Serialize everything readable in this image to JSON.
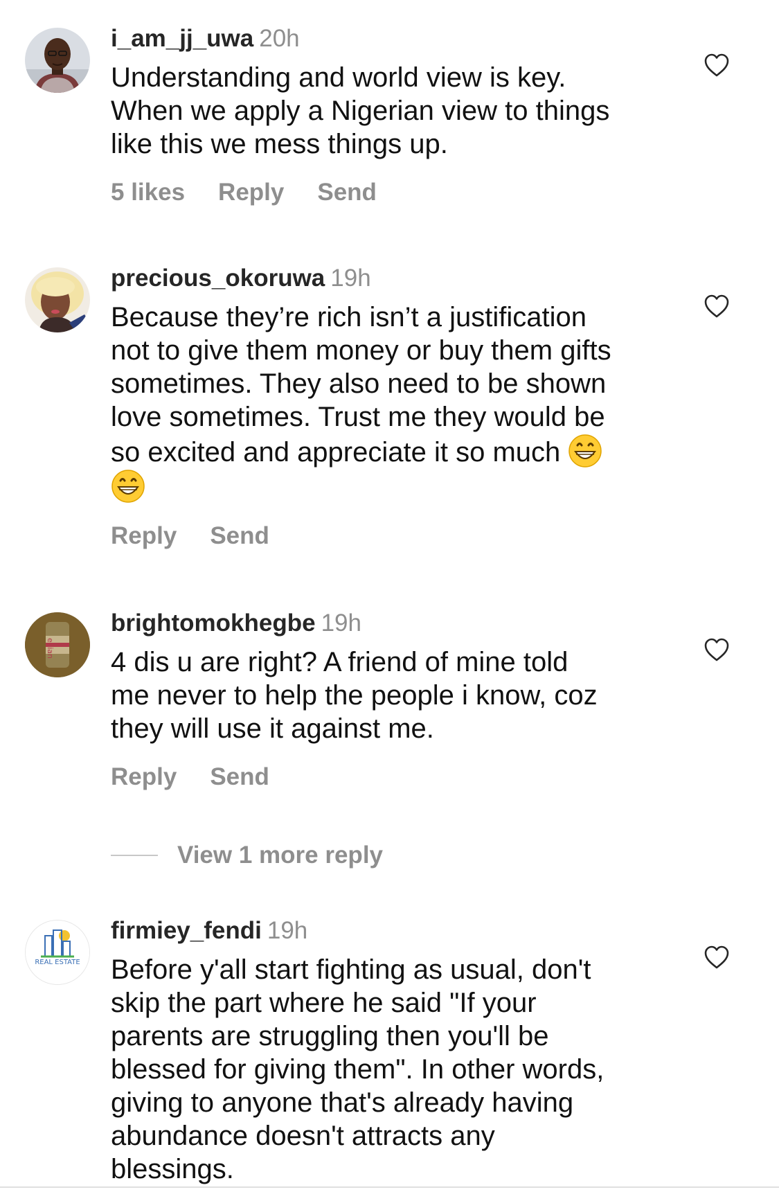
{
  "comments": [
    {
      "username": "i_am_jj_uwa",
      "time": "20h",
      "lines": [
        "Understanding and world view is key.",
        "When we apply a Nigerian view to things",
        "like this we mess things up."
      ],
      "likes": "5 likes",
      "reply": "Reply",
      "send": "Send",
      "avatar_icon": "man-portrait"
    },
    {
      "username": "precious_okoruwa",
      "time": "19h",
      "lines": [
        "Because they’re rich isn’t a justification",
        "not to give them money or buy them gifts",
        "sometimes. They also need to be shown",
        "love sometimes. Trust me they would be",
        "so excited and appreciate it so much"
      ],
      "emoji": "grinning-face-emoji",
      "reply": "Reply",
      "send": "Send",
      "avatar_icon": "woman-portrait"
    },
    {
      "username": "brightomokhegbe",
      "time": "19h",
      "lines": [
        "4 dis u are right? A friend of mine told",
        "me never to help the people i know, coz",
        "they will use it against me."
      ],
      "reply": "Reply",
      "send": "Send",
      "avatar_icon": "evian-bottle",
      "avatar_text": "evian"
    },
    {
      "username": "firmiey_fendi",
      "time": "19h",
      "lines": [
        "Before y'all start fighting as usual, don't",
        "skip the part where he said \"If your",
        "parents are struggling then you'll be",
        "blessed for giving them\". In other words,",
        "giving to anyone that's already having",
        "abundance doesn't attracts any",
        "blessings."
      ],
      "avatar_icon": "real-estate-logo",
      "avatar_text": "REAL ESTATE"
    }
  ],
  "view_more": {
    "label": "View 1 more reply"
  },
  "icons": {
    "like": "heart-outline-icon"
  },
  "colors": {
    "text": "#111111",
    "meta": "#8e8e8e",
    "username": "#262626",
    "background": "#ffffff"
  }
}
